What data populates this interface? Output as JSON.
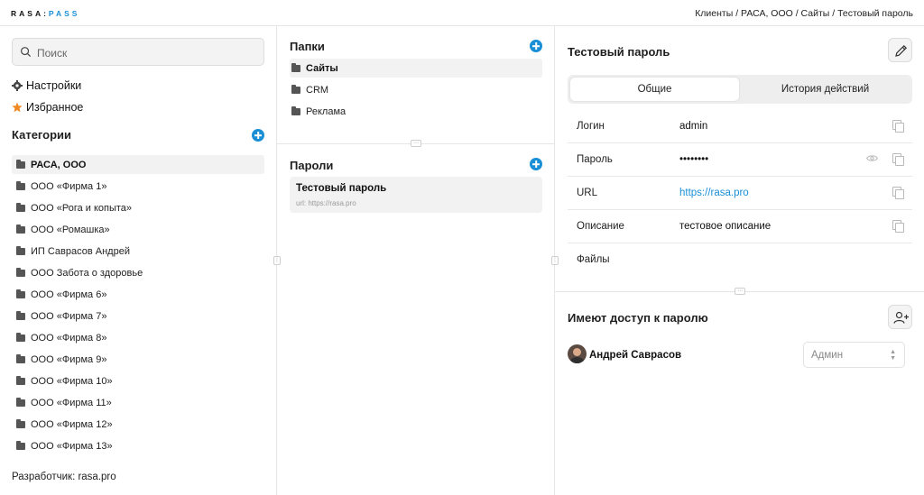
{
  "header": {
    "logo_part1": "RASA:",
    "logo_part2": "PASS",
    "breadcrumb": "Клиенты / РАСА, ООО / Сайты / Тестовый пароль"
  },
  "sidebar": {
    "search_placeholder": "Поиск",
    "settings_label": "Настройки",
    "favorites_label": "Избранное",
    "categories_title": "Категории",
    "categories": [
      "РАСА, ООО",
      "ООО «Фирма 1»",
      "ООО «Рога и копыта»",
      "ООО «Ромашка»",
      "ИП Саврасов Андрей",
      "ООО Забота о здоровье",
      "ООО «Фирма 6»",
      "ООО «Фирма 7»",
      "ООО «Фирма 8»",
      "ООО «Фирма 9»",
      "ООО «Фирма 10»",
      "ООО «Фирма 11»",
      "ООО «Фирма 12»",
      "ООО «Фирма 13»"
    ],
    "active_category": "РАСА, ООО",
    "developer": "Разработчик: rasa.pro"
  },
  "middle": {
    "folders_title": "Папки",
    "folders": [
      "Сайты",
      "CRM",
      "Реклама"
    ],
    "passwords_title": "Пароли",
    "password_item": {
      "title": "Тестовый пароль",
      "url": "url: https://rasa.pro"
    }
  },
  "detail": {
    "title": "Тестовый пароль",
    "tabs": [
      "Общие",
      "История действий"
    ],
    "fields": {
      "login_label": "Логин",
      "login_value": "admin",
      "password_label": "Пароль",
      "password_value": "••••••••",
      "url_label": "URL",
      "url_value": "https://rasa.pro",
      "description_label": "Описание",
      "description_value": "тестовое описание",
      "files_label": "Файлы"
    },
    "access_title": "Имеют доступ к паролю",
    "user_name": "Андрей Саврасов",
    "role_value": "Админ"
  },
  "colors": {
    "accent": "#1a8fd6",
    "star": "#f08a24"
  }
}
